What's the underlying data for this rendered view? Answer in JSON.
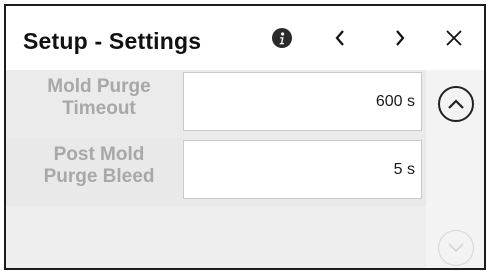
{
  "window": {
    "title": "Setup - Settings"
  },
  "settings": [
    {
      "label": "Mold Purge\nTimeout",
      "value": "600 s"
    },
    {
      "label": "Post Mold\nPurge Bleed",
      "value": "5 s"
    }
  ],
  "icons": {
    "info": "info-icon",
    "previous": "chevron-left-icon",
    "next": "chevron-right-icon",
    "close": "close-icon",
    "scroll_up": "chevron-up-icon",
    "scroll_down": "chevron-down-icon"
  },
  "colors": {
    "label_text": "#a8a8a8",
    "scroll_down_disabled": "#d6d6d6"
  }
}
